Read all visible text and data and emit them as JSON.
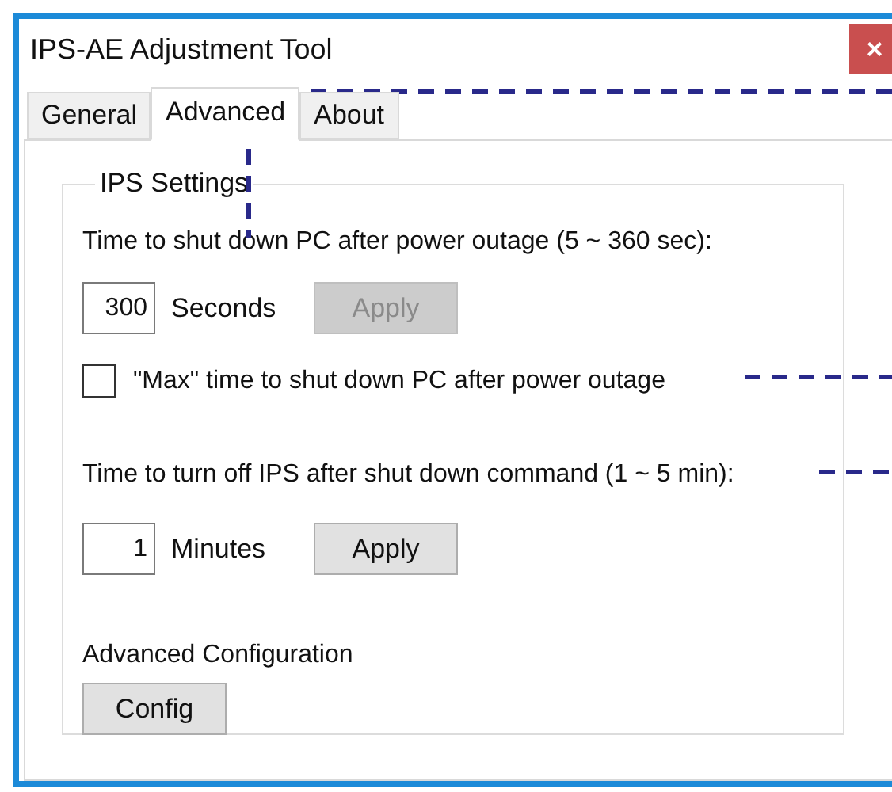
{
  "window": {
    "title": "IPS-AE Adjustment Tool",
    "close_label": "×"
  },
  "tabs": [
    {
      "label": "General",
      "selected": false
    },
    {
      "label": "Advanced",
      "selected": true
    },
    {
      "label": "About",
      "selected": false
    }
  ],
  "group": {
    "title": "IPS Settings",
    "shutdown_label": "Time to shut down PC after power outage (5 ~ 360 sec):",
    "shutdown_value": "300",
    "shutdown_unit": "Seconds",
    "shutdown_apply": {
      "label": "Apply",
      "disabled": true
    },
    "max_checkbox": {
      "label": "\"Max\" time to shut down PC after power outage",
      "checked": false
    },
    "ips_off_label": "Time to turn off IPS after shut down command (1 ~ 5 min):",
    "ips_off_value": "1",
    "ips_off_unit": "Minutes",
    "ips_off_apply": {
      "label": "Apply",
      "disabled": false
    },
    "advanced_label": "Advanced Configuration",
    "config_button": "Config"
  }
}
